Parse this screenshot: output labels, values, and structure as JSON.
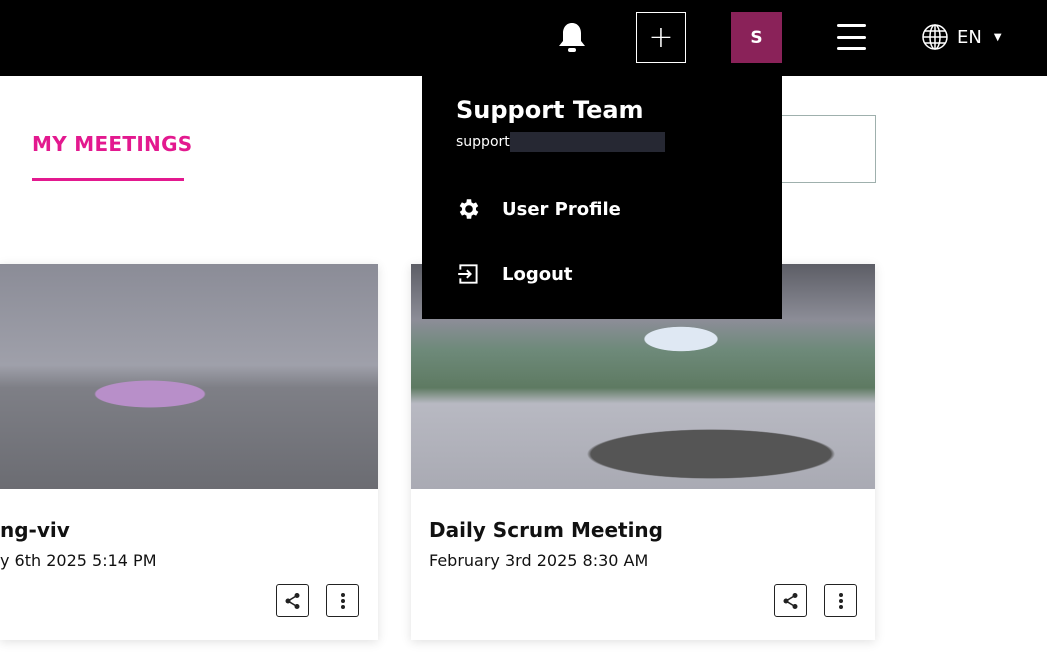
{
  "header": {
    "avatar_initial": "S",
    "language": "EN",
    "icons": [
      "bell-icon",
      "plus-icon",
      "hamburger-menu-icon",
      "globe-icon",
      "caret-down-icon"
    ]
  },
  "tabs": [
    {
      "label": "MY MEETINGS",
      "active": true
    }
  ],
  "accent_color": "#e3198f",
  "avatar_color": "#8a2259",
  "meetings": [
    {
      "title": "ng-viv",
      "date": "y 6th 2025 5:14 PM"
    },
    {
      "title": "Daily Scrum Meeting",
      "date": "February 3rd 2025 8:30 AM"
    }
  ],
  "user_menu": {
    "name": "Support Team",
    "email_prefix": "support",
    "items": [
      {
        "label": "User Profile",
        "icon": "gear-icon"
      },
      {
        "label": "Logout",
        "icon": "logout-icon"
      }
    ]
  }
}
